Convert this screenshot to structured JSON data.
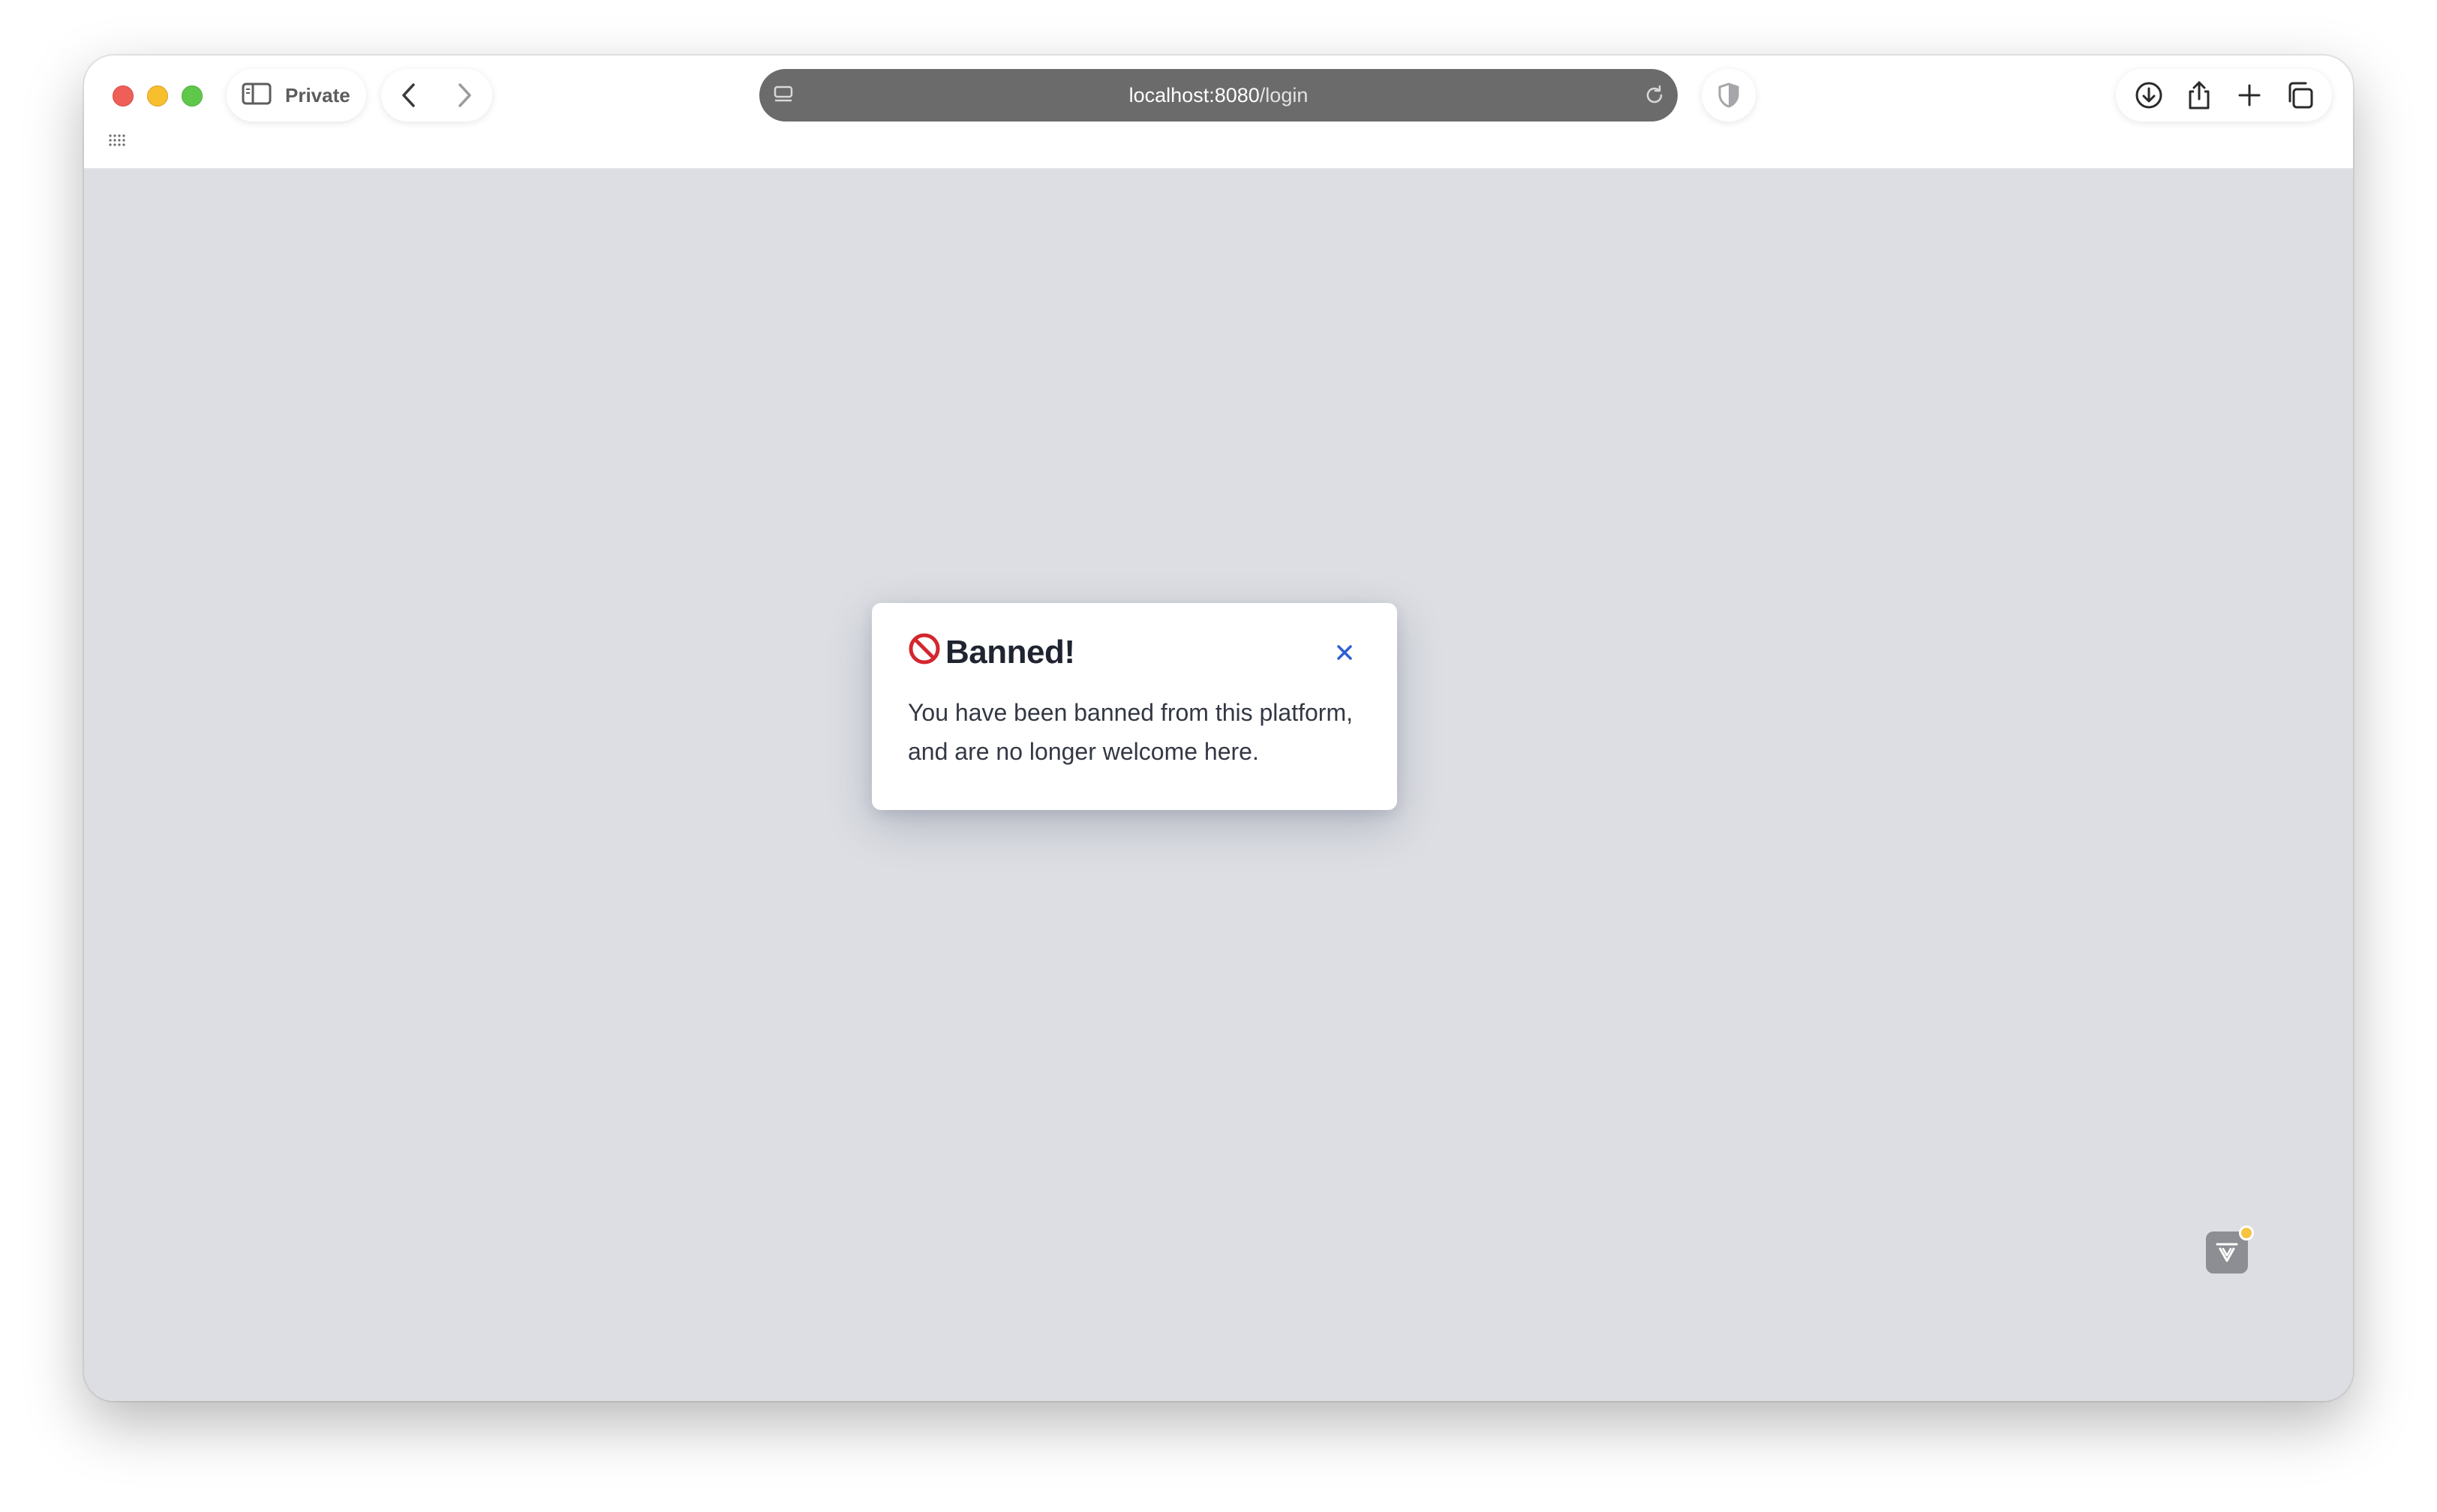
{
  "browser": {
    "private_label": "Private",
    "url": {
      "host": "localhost:8080",
      "path": "/login"
    }
  },
  "modal": {
    "emoji": "🚫",
    "title": "Banned!",
    "message": "You have been banned from this platform, and are no longer welcome here."
  },
  "icons": {
    "close": "close-icon",
    "shield": "shield-icon",
    "download": "download-icon",
    "share": "share-icon",
    "new_tab": "plus-icon",
    "tabs": "tabs-overview-icon",
    "sidebar": "sidebar-icon",
    "back": "chevron-left-icon",
    "forward": "chevron-right-icon",
    "reload": "reload-icon",
    "apps": "grid-icon",
    "extension": "extension-icon"
  },
  "colors": {
    "page_bg": "#dcdee3",
    "url_bar_bg": "#6b6b6b",
    "close_icon": "#2d5fd3",
    "traffic_red": "#ee5f57",
    "traffic_yellow": "#f7be2e",
    "traffic_green": "#5fc84b",
    "badge_dot": "#f6c343"
  }
}
